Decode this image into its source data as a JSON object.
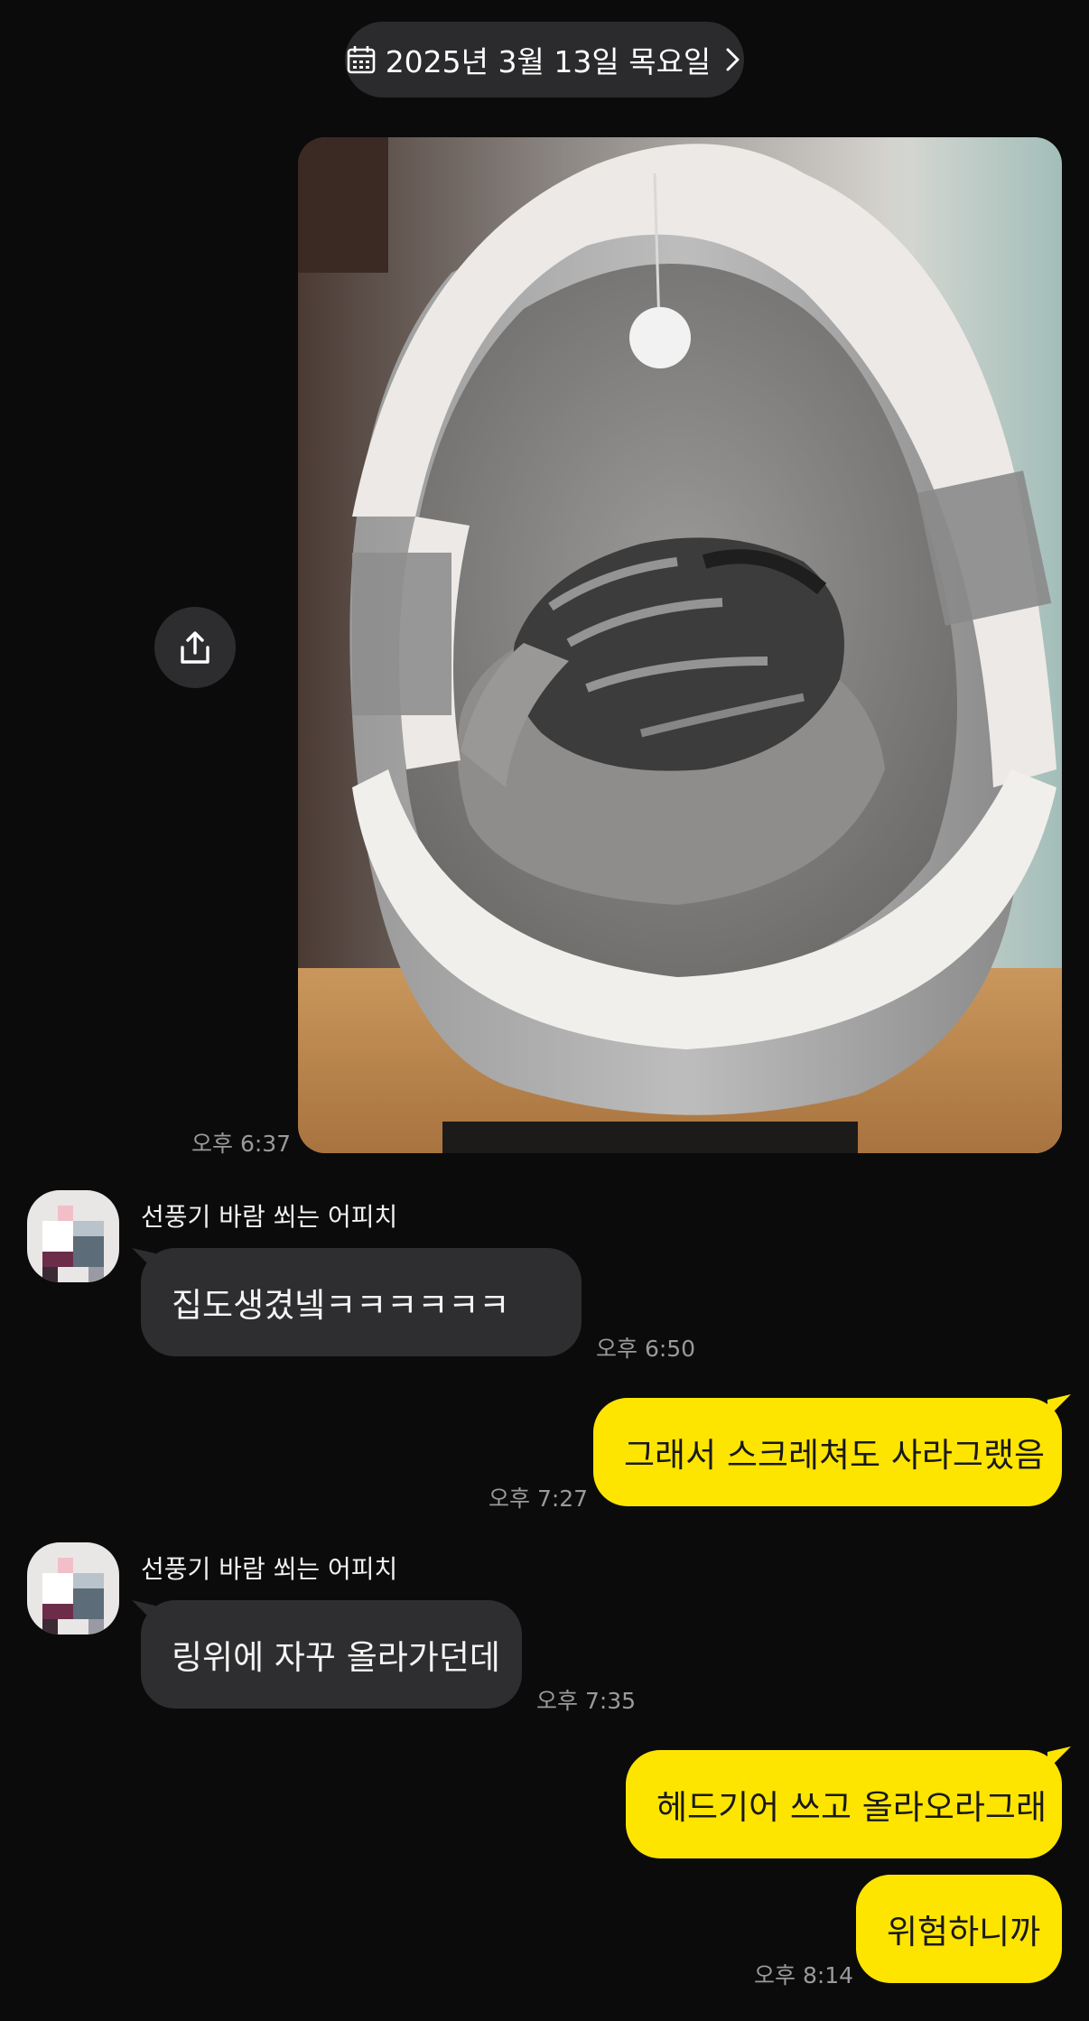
{
  "date_divider": {
    "label": "2025년 3월 13일 목요일"
  },
  "photo_message": {
    "time": "오후 6:37",
    "alt": "cat sleeping in gray cat bed"
  },
  "colors": {
    "background": "#0b0b0b",
    "my_bubble": "#fee500",
    "their_bubble": "#2e2e30"
  },
  "icons": {
    "date": "calendar-icon",
    "date_arrow": "chevron-right-icon",
    "share": "share-icon"
  },
  "messages": [
    {
      "sender": "선풍기 바람 쐬는 어피치",
      "text": "집도생겼넼ㅋㅋㅋㅋㅋㅋ",
      "time": "오후 6:50"
    },
    {
      "text": "그래서 스크레쳐도 사라그랬음",
      "time": "오후 7:27"
    },
    {
      "sender": "선풍기 바람 쐬는 어피치",
      "text": "링위에 자꾸 올라가던데",
      "time": "오후 7:35"
    },
    {
      "text": "헤드기어 쓰고 올라오라그래"
    },
    {
      "text": "위험하니까",
      "time": "오후 8:14"
    }
  ]
}
